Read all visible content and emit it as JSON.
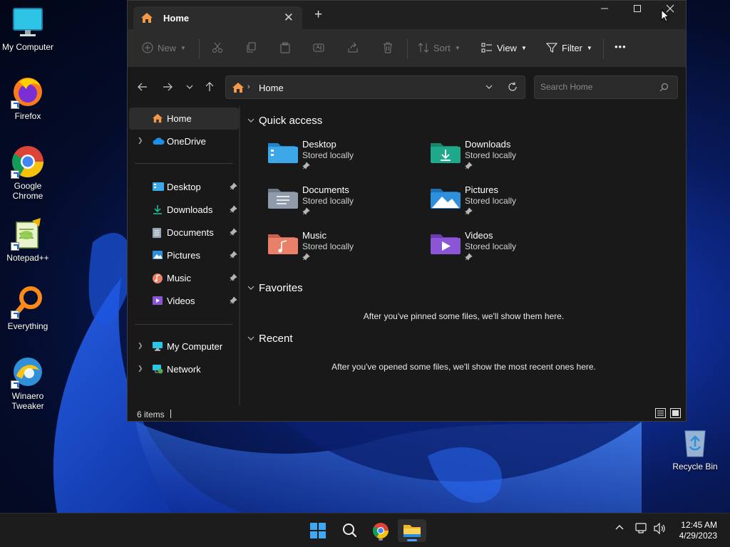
{
  "desktop": {
    "icons": [
      {
        "label": "My Computer"
      },
      {
        "label": "Firefox"
      },
      {
        "label": "Google Chrome"
      },
      {
        "label": "Notepad++"
      },
      {
        "label": "Everything"
      },
      {
        "label": "Winaero Tweaker"
      },
      {
        "label": "Recycle Bin"
      }
    ]
  },
  "window": {
    "tab_title": "Home",
    "toolbar": {
      "new_label": "New",
      "sort_label": "Sort",
      "view_label": "View",
      "filter_label": "Filter",
      "more_label": "•••"
    },
    "address": {
      "crumb": "Home"
    },
    "search": {
      "placeholder": "Search Home"
    },
    "sidebar": {
      "items": [
        {
          "label": "Home",
          "selected": true
        },
        {
          "label": "OneDrive"
        },
        {
          "label": "Desktop",
          "pinned": true
        },
        {
          "label": "Downloads",
          "pinned": true
        },
        {
          "label": "Documents",
          "pinned": true
        },
        {
          "label": "Pictures",
          "pinned": true
        },
        {
          "label": "Music",
          "pinned": true
        },
        {
          "label": "Videos",
          "pinned": true
        },
        {
          "label": "My Computer"
        },
        {
          "label": "Network"
        }
      ]
    },
    "main": {
      "quick_access": {
        "heading": "Quick access",
        "items": [
          {
            "name": "Desktop",
            "location": "Stored locally",
            "color": "#3da8e8"
          },
          {
            "name": "Downloads",
            "location": "Stored locally",
            "color": "#1fa88a"
          },
          {
            "name": "Documents",
            "location": "Stored locally",
            "color": "#8f9bab"
          },
          {
            "name": "Pictures",
            "location": "Stored locally",
            "color": "#2e8fdb"
          },
          {
            "name": "Music",
            "location": "Stored locally",
            "color": "#e8806a"
          },
          {
            "name": "Videos",
            "location": "Stored locally",
            "color": "#8a56d6"
          }
        ]
      },
      "favorites": {
        "heading": "Favorites",
        "empty_text": "After you've pinned some files, we'll show them here."
      },
      "recent": {
        "heading": "Recent",
        "empty_text": "After you've opened some files, we'll show the most recent ones here."
      }
    },
    "status": {
      "item_count": "6 items"
    }
  },
  "taskbar": {
    "clock": {
      "time": "12:45 AM",
      "date": "4/29/2023"
    }
  },
  "colors": {
    "accent": "#4aa3ff",
    "window_bg": "#191919",
    "toolbar_bg": "#2c2c2c"
  }
}
